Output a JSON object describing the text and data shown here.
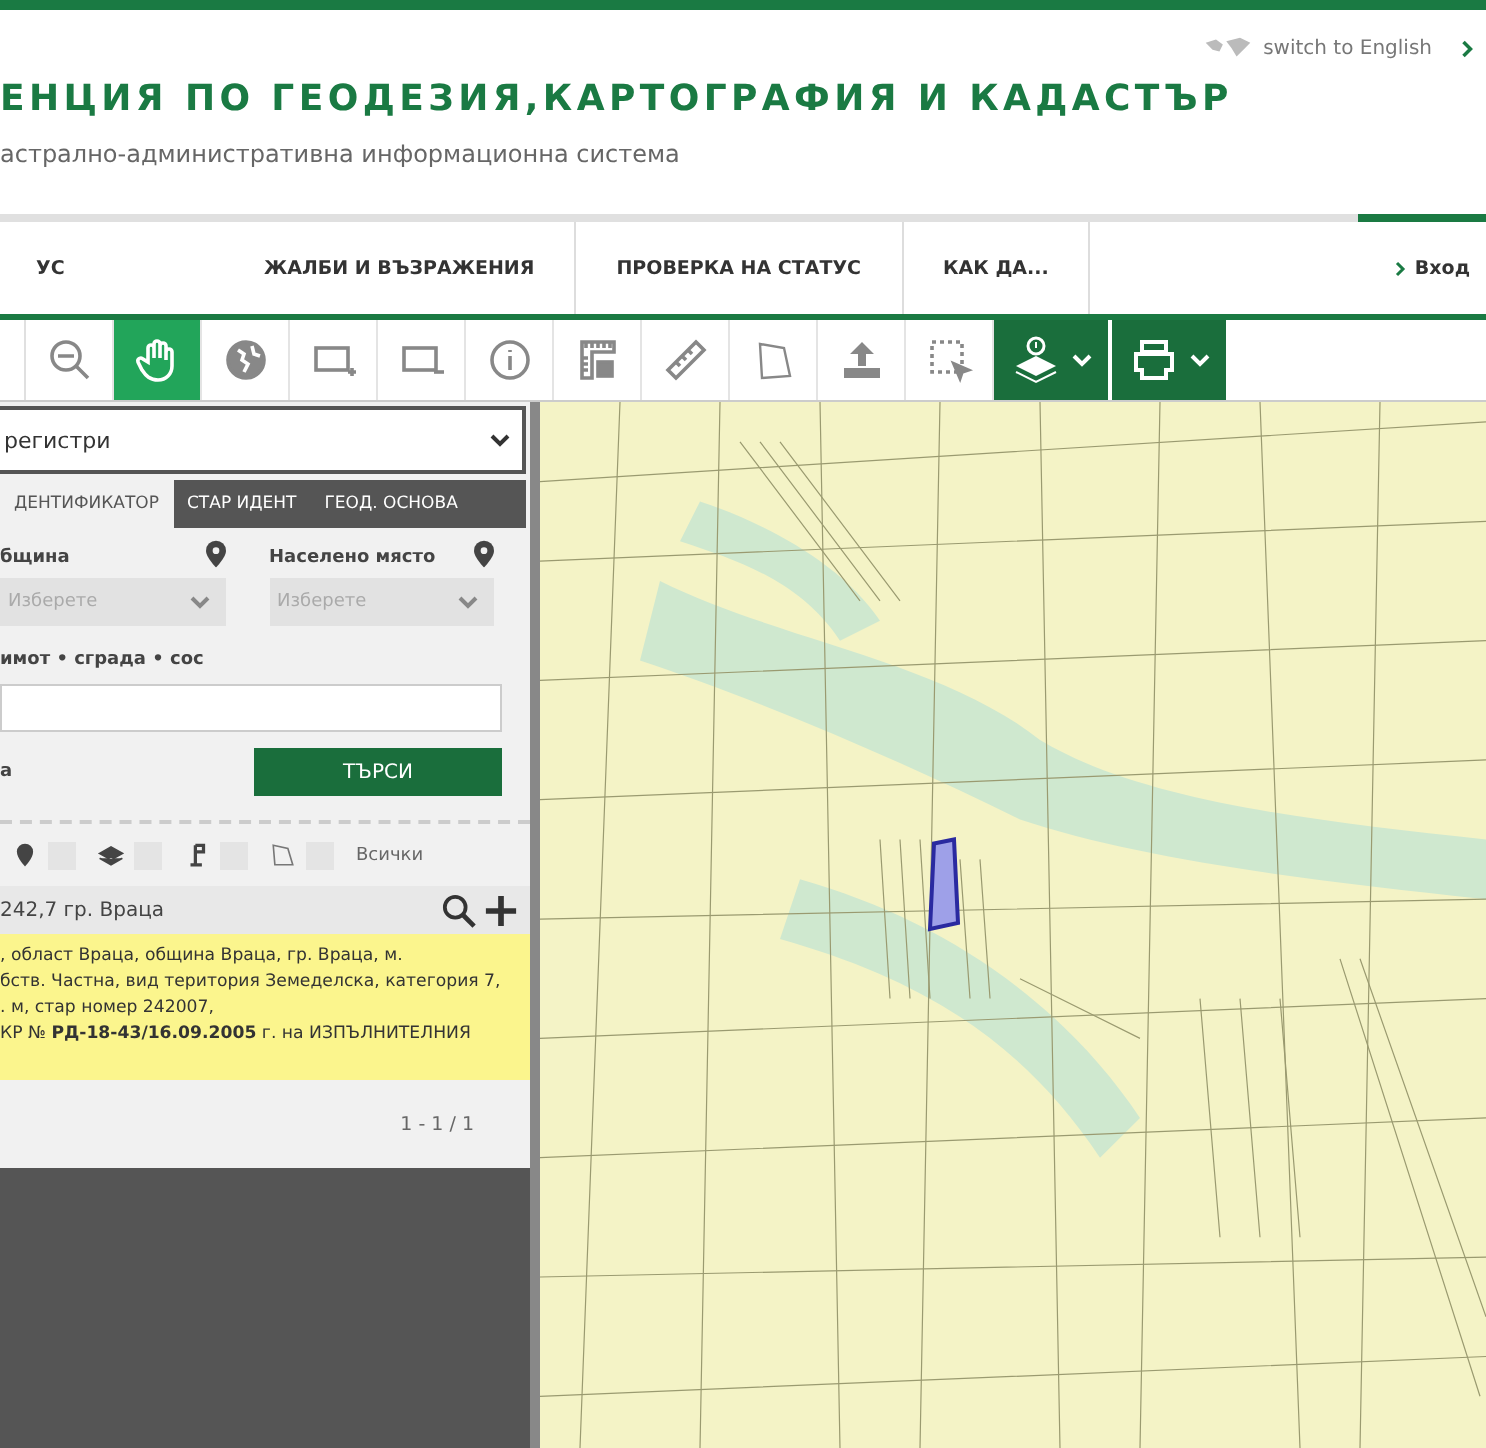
{
  "header": {
    "language_link": "switch to English",
    "title": "ЕНЦИЯ ПО ГЕОДЕЗИЯ,КАРТОГРАФИЯ И КАДАСТЪР",
    "subtitle": "астрално-административна информационна система"
  },
  "nav": {
    "items": [
      "УС",
      "ЖАЛБИ И ВЪЗРАЖЕНИЯ",
      "ПРОВЕРКА НА СТАТУС",
      "КАК ДА..."
    ],
    "login": "Вход"
  },
  "toolbar": {
    "tools": [
      {
        "kind": "zoom-out",
        "selected": false
      },
      {
        "kind": "pan",
        "selected": true
      },
      {
        "kind": "globe",
        "selected": false
      },
      {
        "kind": "rect-add",
        "selected": false
      },
      {
        "kind": "rect-remove",
        "selected": false
      },
      {
        "kind": "info",
        "selected": false
      },
      {
        "kind": "grid",
        "selected": false
      },
      {
        "kind": "ruler",
        "selected": false
      },
      {
        "kind": "polygon",
        "selected": false
      },
      {
        "kind": "upload",
        "selected": false
      },
      {
        "kind": "select",
        "selected": false
      }
    ],
    "menus": [
      {
        "kind": "layers"
      },
      {
        "kind": "print"
      }
    ]
  },
  "panel": {
    "register": "регистри",
    "tabs": [
      {
        "label": "ДЕНТИФИКАТОР",
        "selected": true
      },
      {
        "label": "СТАР ИДЕНТ",
        "selected": false
      },
      {
        "label": "ГЕОД. ОСНОВА",
        "selected": false
      }
    ],
    "fields": [
      {
        "label": "бщина",
        "placeholder": "Изберете",
        "disabled": true
      },
      {
        "label": "Населено място",
        "placeholder": "Изберете",
        "disabled": true
      }
    ],
    "identifier_label": "имот • сграда • сос",
    "side_label": "а",
    "search_button": "ТЪРСИ",
    "filters": [
      {
        "kind": "pin",
        "checked": false
      },
      {
        "kind": "layers",
        "checked": false
      },
      {
        "kind": "flag",
        "checked": false
      },
      {
        "kind": "polygon",
        "checked": false
      }
    ],
    "filter_all": "Всички",
    "result": {
      "title": "242,7 гр. Враца",
      "lines": [
        ", област Враца, община Враца, гр. Враца, м.",
        "бств. Частна, вид територия Земеделска, категория 7,",
        ". м, стар номер 242007,",
        "КР № **РД-18-43/16.09.2005** г. на ИЗПЪЛНИТЕЛНИЯ"
      ]
    },
    "pager": "1 - 1 / 1"
  }
}
